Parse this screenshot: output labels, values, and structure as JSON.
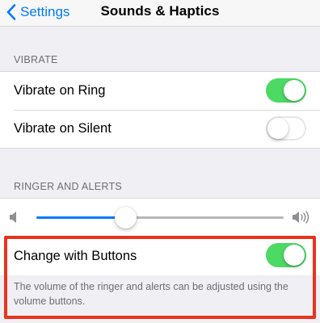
{
  "navbar": {
    "back_label": "Settings",
    "title": "Sounds & Haptics"
  },
  "vibrate_section": {
    "header": "VIBRATE",
    "rows": [
      {
        "label": "Vibrate on Ring",
        "state": "on"
      },
      {
        "label": "Vibrate on Silent",
        "state": "off"
      }
    ]
  },
  "ringer_section": {
    "header": "RINGER AND ALERTS",
    "volume_level": 0.36,
    "change_with_buttons": {
      "label": "Change with Buttons",
      "state": "on"
    },
    "footer": "The volume of the ringer and alerts can be adjusted using the volume buttons."
  },
  "colors": {
    "accent": "#007aff",
    "toggle_on": "#4cd964",
    "highlight_border": "#e8341c",
    "background": "#efeff4"
  }
}
